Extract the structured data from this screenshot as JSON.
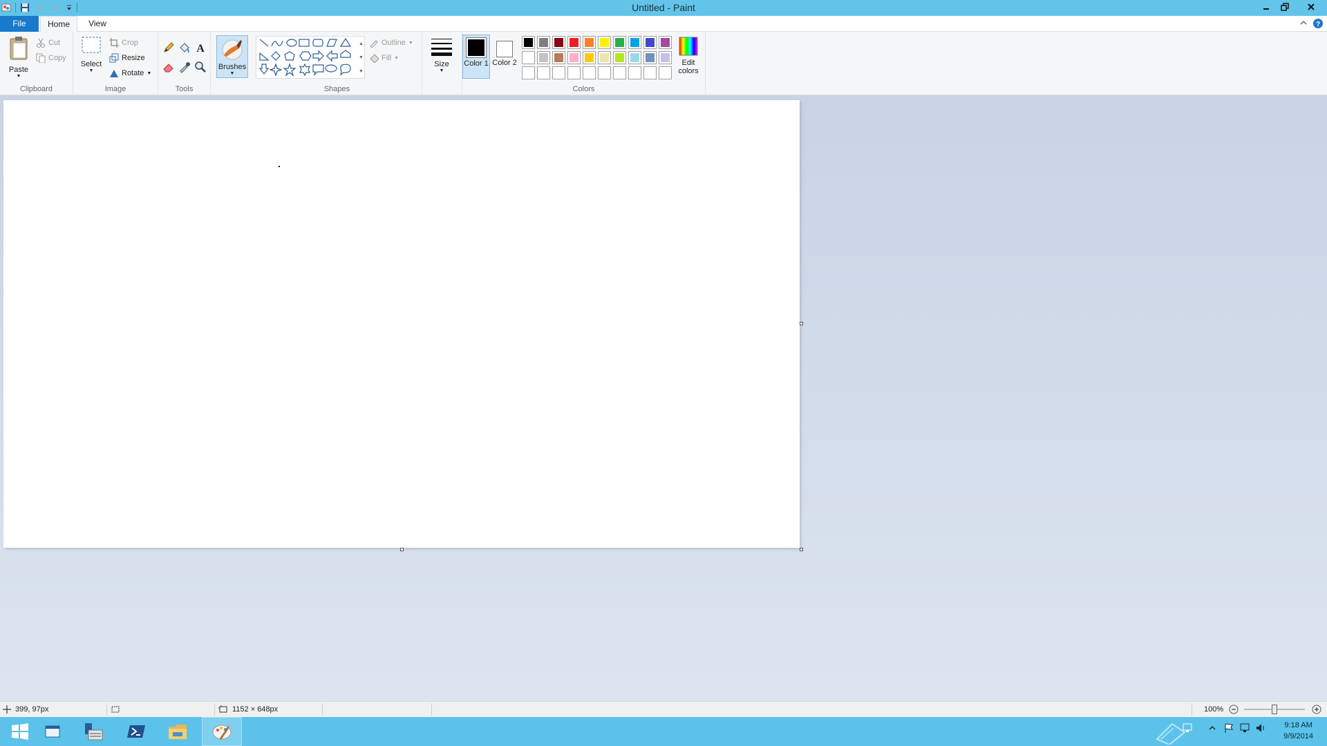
{
  "window": {
    "title": "Untitled - Paint"
  },
  "tabs": {
    "file": "File",
    "home": "Home",
    "view": "View"
  },
  "clipboard": {
    "label": "Clipboard",
    "paste": "Paste",
    "cut": "Cut",
    "copy": "Copy"
  },
  "image": {
    "label": "Image",
    "select": "Select",
    "crop": "Crop",
    "resize": "Resize",
    "rotate": "Rotate"
  },
  "tools": {
    "label": "Tools",
    "brushes": "Brushes"
  },
  "shapes": {
    "label": "Shapes",
    "outline": "Outline",
    "fill": "Fill"
  },
  "size": {
    "label": "Size"
  },
  "colors": {
    "label": "Colors",
    "color1": "Color 1",
    "color2": "Color 2",
    "edit": "Edit colors",
    "color1_value": "#000000",
    "color2_value": "#ffffff",
    "palette_row1": [
      "#000000",
      "#7f7f7f",
      "#880015",
      "#ed1c24",
      "#ff7f27",
      "#fff200",
      "#22b14c",
      "#00a2e8",
      "#3f48cc",
      "#a349a4"
    ],
    "palette_row2": [
      "#ffffff",
      "#c3c3c3",
      "#b97a57",
      "#ffaec9",
      "#ffc90e",
      "#efe4b0",
      "#b5e61d",
      "#99d9ea",
      "#7092be",
      "#c8bfe7"
    ]
  },
  "status": {
    "cursor_pos": "399, 97px",
    "canvas_size": "1152 × 648px",
    "zoom": "100%"
  },
  "taskbar": {
    "time": "9:18 AM",
    "date": "9/9/2014"
  }
}
